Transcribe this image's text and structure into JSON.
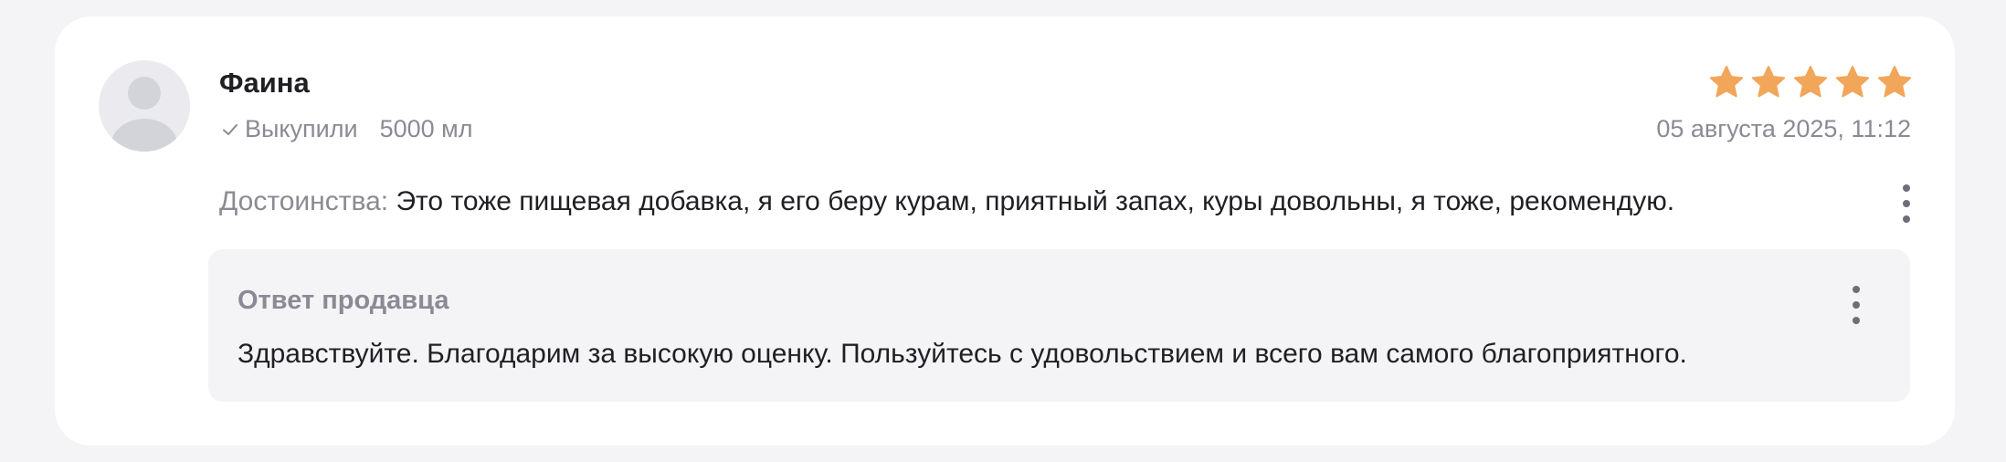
{
  "review": {
    "author": "Фаина",
    "purchased_label": "Выкупили",
    "volume": "5000 мл",
    "date": "05 августа 2025, 11:12",
    "rating": 5,
    "rating_max": 5,
    "star_color": "#f2a65a",
    "pros_label": "Достоинства:",
    "pros_text": "Это тоже пищевая добавка, я его беру курам, приятный запах, куры довольны, я тоже, рекомендую."
  },
  "seller_reply": {
    "title": "Ответ продавца",
    "text": "Здравствуйте. Благодарим за высокую оценку. Пользуйтесь с удовольствием и всего вам самого благоприятного."
  }
}
